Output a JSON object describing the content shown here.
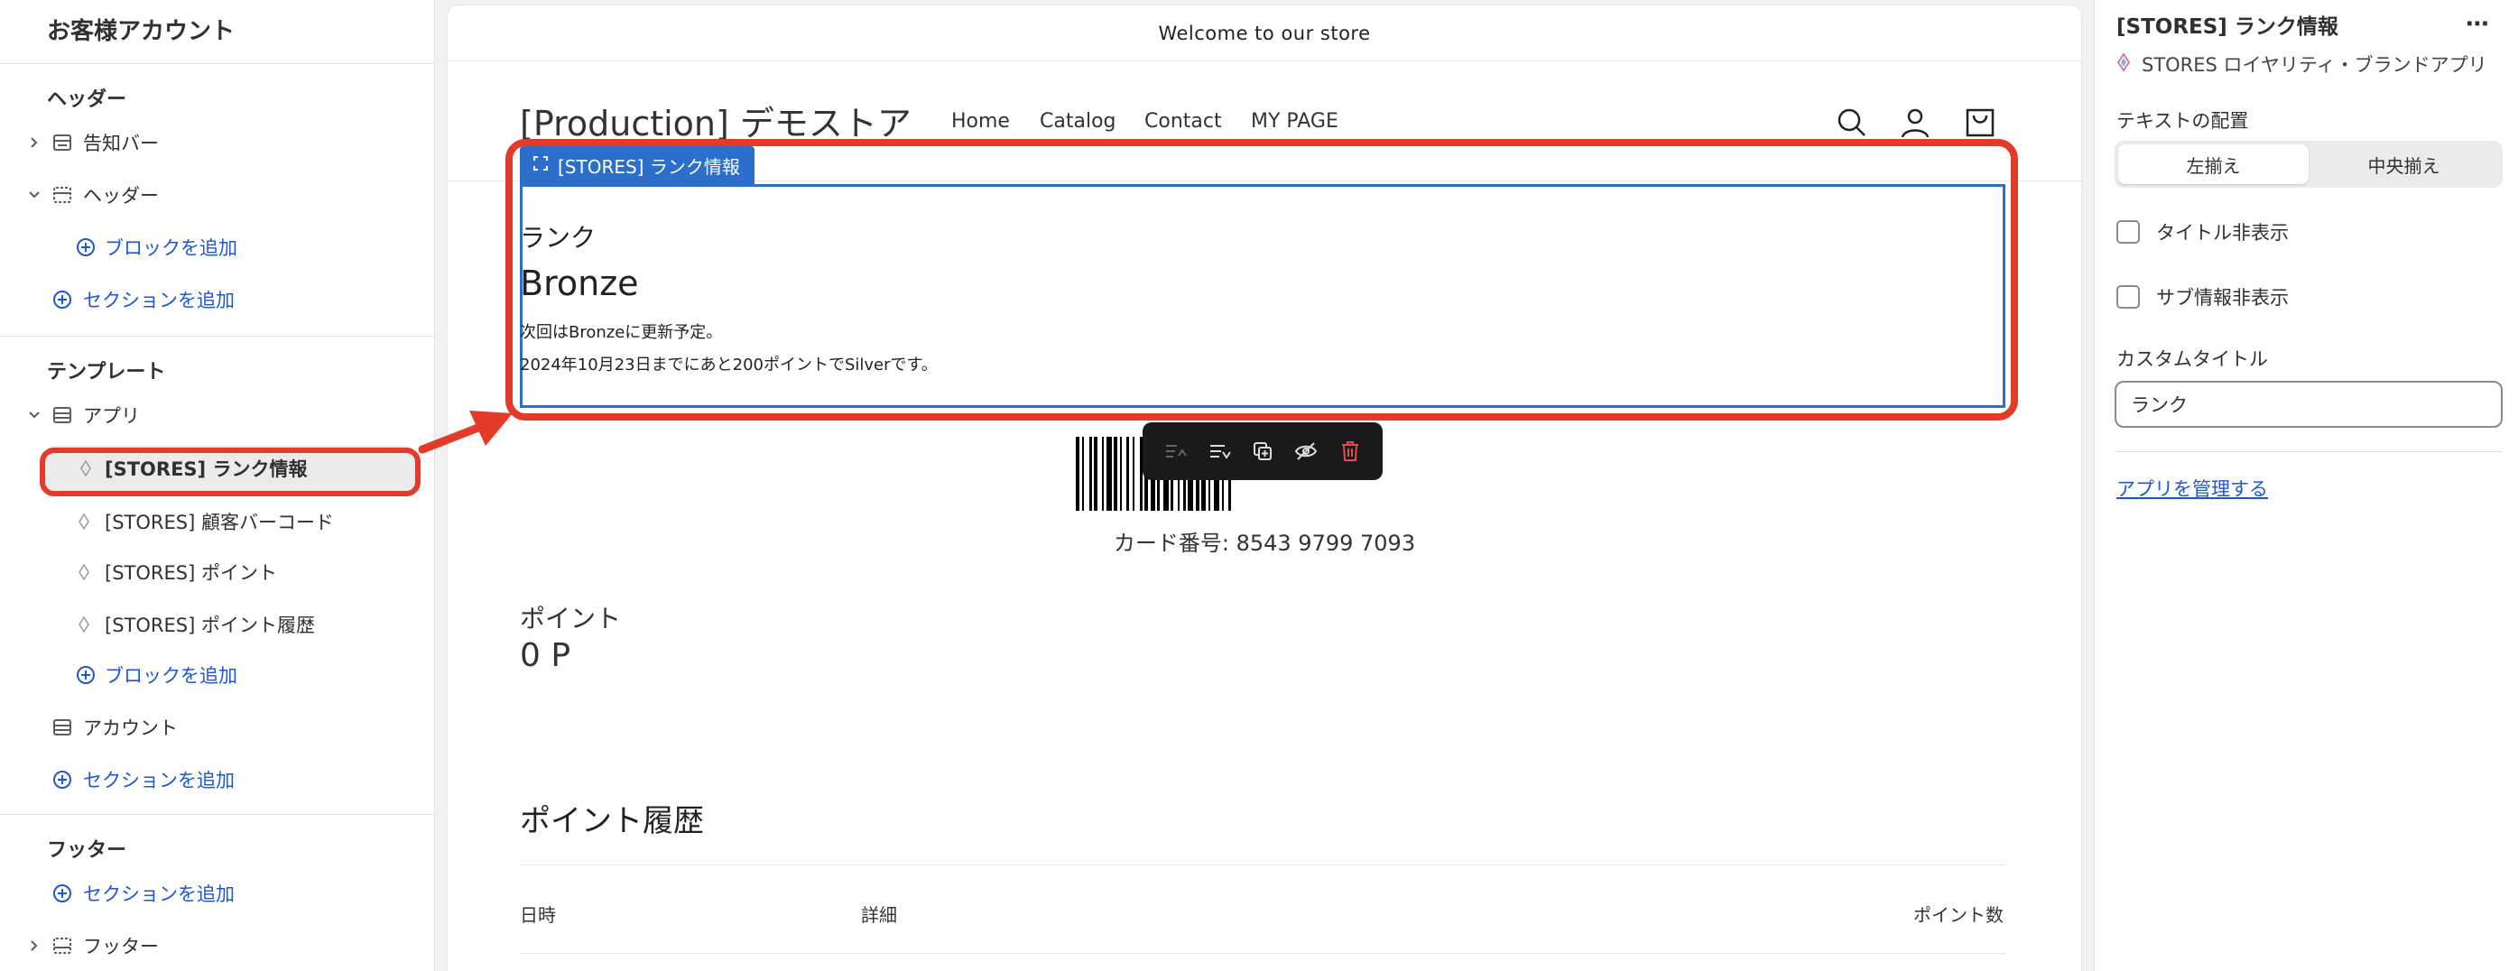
{
  "left_panel": {
    "title": "お客様アカウント",
    "header_group": {
      "title": "ヘッダー",
      "items": [
        {
          "label": "告知バー"
        },
        {
          "label": "ヘッダー"
        }
      ],
      "add_block": "ブロックを追加",
      "add_section": "セクションを追加"
    },
    "template_group": {
      "title": "テンプレート",
      "app_label": "アプリ",
      "blocks": [
        {
          "label": "[STORES] ランク情報"
        },
        {
          "label": "[STORES] 顧客バーコード"
        },
        {
          "label": "[STORES] ポイント"
        },
        {
          "label": "[STORES] ポイント履歴"
        }
      ],
      "add_block": "ブロックを追加",
      "account_label": "アカウント",
      "add_section": "セクションを追加"
    },
    "footer_group": {
      "title": "フッター",
      "add_section": "セクションを追加",
      "footer_label": "フッター"
    }
  },
  "preview": {
    "announcement": "Welcome to our store",
    "brand": "[Production] デモストア",
    "nav": [
      "Home",
      "Catalog",
      "Contact",
      "MY PAGE"
    ],
    "block_tag": "[STORES] ランク情報",
    "rank_label": "ランク",
    "rank_name": "Bronze",
    "rank_note_1": "次回はBronzeに更新予定。",
    "rank_note_2": "2024年10月23日までにあと200ポイントでSilverです。",
    "card_number": "カード番号: 8543 9799 7093",
    "points_label": "ポイント",
    "points_value": "0 P",
    "history_title": "ポイント履歴",
    "history_columns": [
      "日時",
      "詳細",
      "ポイント数"
    ]
  },
  "right_panel": {
    "title": "[STORES] ランク情報",
    "more": "⋯",
    "app_name": "STORES ロイヤリティ・ブランドアプリ",
    "alignment_label": "テキストの配置",
    "alignment_options": [
      "左揃え",
      "中央揃え"
    ],
    "hide_title": "タイトル非表示",
    "hide_sub": "サブ情報非表示",
    "custom_title_label": "カスタムタイトル",
    "custom_title_value": "ランク",
    "manage_app": "アプリを管理する"
  },
  "colors": {
    "accent_blue": "#2c6ecb",
    "link_blue": "#1d56d6",
    "annotation_red": "#e33a2a"
  },
  "icons": {
    "collapse": "chevron-right-icon",
    "expand": "chevron-down-icon",
    "section": "section-icon",
    "add": "plus-circle-icon",
    "app_block": "app-block-icon",
    "search": "search-icon",
    "account": "account-icon",
    "cart": "cart-icon"
  }
}
